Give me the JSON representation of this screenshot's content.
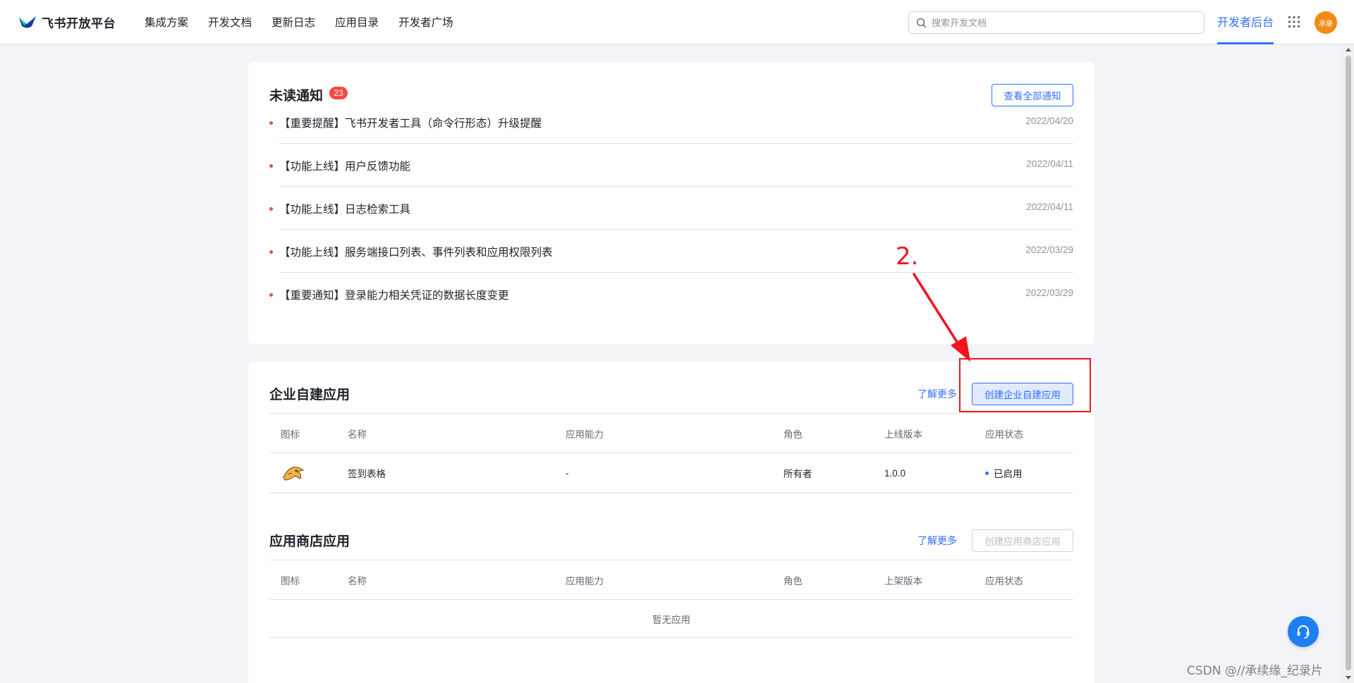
{
  "header": {
    "logo_text": "飞书开放平台",
    "nav": [
      "集成方案",
      "开发文档",
      "更新日志",
      "应用目录",
      "开发者广场"
    ],
    "search_placeholder": "搜索开发文档",
    "dev_console": "开发者后台",
    "avatar_text": "承康",
    "accent_color": "#3370ff"
  },
  "notices": {
    "title": "未读通知",
    "badge": "23",
    "view_all": "查看全部通知",
    "items": [
      {
        "text": "【重要提醒】飞书开发者工具（命令行形态）升级提醒",
        "date": "2022/04/20"
      },
      {
        "text": "【功能上线】用户反馈功能",
        "date": "2022/04/11"
      },
      {
        "text": "【功能上线】日志检索工具",
        "date": "2022/04/11"
      },
      {
        "text": "【功能上线】服务端接口列表、事件列表和应用权限列表",
        "date": "2022/03/29"
      },
      {
        "text": "【重要通知】登录能力相关凭证的数据长度变更",
        "date": "2022/03/29"
      }
    ]
  },
  "custom_apps": {
    "title": "企业自建应用",
    "learn_more": "了解更多",
    "create_button": "创建企业自建应用",
    "columns": [
      "图标",
      "名称",
      "应用能力",
      "角色",
      "上线版本",
      "应用状态"
    ],
    "rows": [
      {
        "icon": "app-logo-icon",
        "name": "签到表格",
        "capability": "-",
        "role": "所有者",
        "version": "1.0.0",
        "status": "已启用"
      }
    ]
  },
  "store_apps": {
    "title": "应用商店应用",
    "learn_more": "了解更多",
    "create_button": "创建应用商店应用",
    "columns": [
      "图标",
      "名称",
      "应用能力",
      "角色",
      "上架版本",
      "应用状态"
    ],
    "empty_text": "暂无应用"
  },
  "annotation": {
    "label": "2.",
    "color": "#f0151f"
  },
  "watermark": "CSDN @//承续缘_纪录片"
}
